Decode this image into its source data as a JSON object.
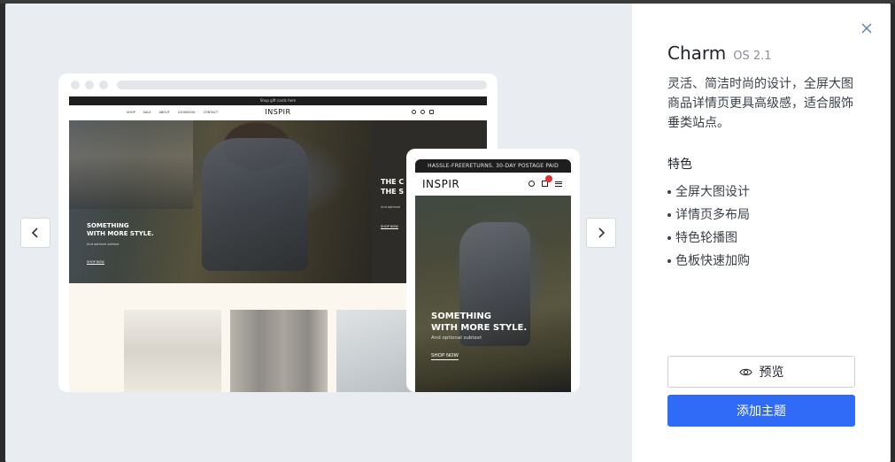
{
  "modal": {
    "title": "Charm",
    "version": "OS 2.1",
    "description": "灵活、简洁时尚的设计，全屏大图商品详情页更具高级感，适合服饰垂类站点。",
    "features_heading": "特色",
    "features": [
      "全屏大图设计",
      "详情页多布局",
      "特色轮播图",
      "色板快速加购"
    ],
    "preview_label": "预览",
    "add_theme_label": "添加主题",
    "close_icon": "close-icon",
    "accent_color": "#2f6bf7"
  },
  "preview": {
    "desktop": {
      "announcement": "Shop gift cards here",
      "logo": "INSPIR",
      "nav": [
        "SHOP",
        "SALE",
        "ABOUT",
        "LOOKBOOK",
        "CONTACT"
      ],
      "hero_heading": "SOMETHING\nWITH MORE STYLE.",
      "hero_sub": "And optional subtext",
      "hero_cta": "SHOP NOW",
      "hero_right_heading": "THE C\nTHE S",
      "hero_right_sub": "And optional",
      "hero_right_cta": "SHOP NOW"
    },
    "mobile": {
      "announcement": "HASSLE-FREERETURNS. 30-DAY POSTAGE PAID",
      "logo": "INSPIR",
      "hero_heading": "SOMETHING\nWITH MORE STYLE.",
      "hero_sub": "And optional subtext",
      "hero_cta": "SHOP NOW"
    }
  }
}
